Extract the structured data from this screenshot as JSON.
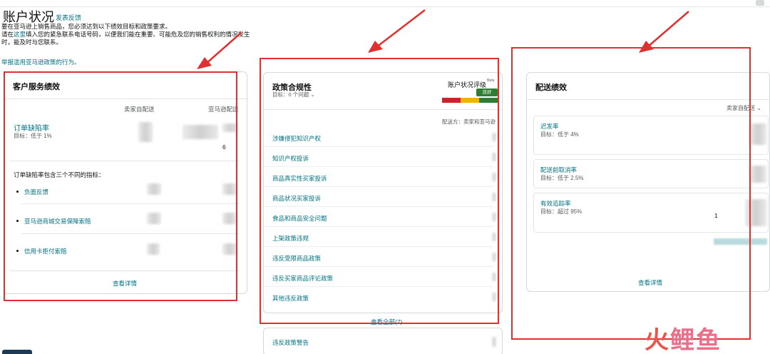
{
  "header": {
    "title": "账户状况",
    "feedback_link": "发表反馈",
    "intro_line1": "要在亚马逊上销售商品，您必须达到以下绩效目标和政策要求。",
    "intro_line2_pre": "请在",
    "intro_line2_link": "这里",
    "intro_line2_post": "填入您的紧急联系电话号码，以便我们能在重要、可能危及您的销售权利的情况发生时，能及时与您联系。",
    "report_link": "举报滥用亚马逊政策的行为。"
  },
  "customer_service": {
    "title": "客户服务绩效",
    "col_fbm": "卖家自配送",
    "col_fba": "亚马逊配送",
    "odr_label": "订单缺陷率",
    "odr_target": "目标：低于 1%",
    "partial_value": "6",
    "subtext": "订单缺陷率包含三个不同的指标：",
    "sub_metrics": [
      "负面反馈",
      "亚马逊商城交易保障索赔",
      "信用卡拒付索赔"
    ],
    "view_details": "查看详情"
  },
  "policy": {
    "title": "政策合规性",
    "target_text": "目标：0 个问题",
    "rating_label": "账户状况评级",
    "beta": "Beta",
    "rating_badge": "良好",
    "ship_by": "配送方：卖家和亚马逊",
    "items": [
      "涉嫌侵犯知识产权",
      "知识产权投诉",
      "商品真实性买家投诉",
      "商品状况买家投诉",
      "食品和商品安全问题",
      "上架政策违规",
      "违反受限商品政策",
      "违反买家商品评论政策",
      "其他违反政策"
    ],
    "view_all": "查看全部(7)",
    "warnings": "违反政策警告",
    "colors": {
      "red": "#c7242b",
      "yellow": "#f0b400",
      "green": "#2e7d32"
    }
  },
  "delivery": {
    "title": "配送绩效",
    "dropdown_label": "卖家自配送",
    "metrics": [
      {
        "name": "迟发率",
        "target": "目标：低于 4%"
      },
      {
        "name": "配送前取消率",
        "target": "目标：低于 2.5%"
      },
      {
        "name": "有效追踪率",
        "target": "目标：超过 95%"
      }
    ],
    "partial_value": "1",
    "view_details": "查看详情"
  },
  "watermark": {
    "part1": "火",
    "part2": "鲤鱼"
  },
  "annotation_color": "#e03131"
}
